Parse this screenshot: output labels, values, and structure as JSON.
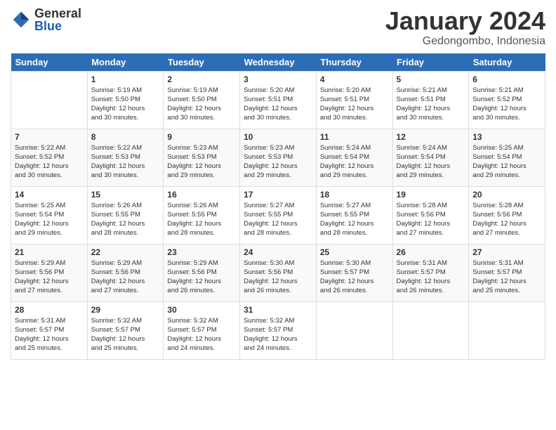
{
  "header": {
    "logo_general": "General",
    "logo_blue": "Blue",
    "month_title": "January 2024",
    "location": "Gedongombo, Indonesia"
  },
  "days_of_week": [
    "Sunday",
    "Monday",
    "Tuesday",
    "Wednesday",
    "Thursday",
    "Friday",
    "Saturday"
  ],
  "weeks": [
    [
      {
        "day": "",
        "info": ""
      },
      {
        "day": "1",
        "info": "Sunrise: 5:19 AM\nSunset: 5:50 PM\nDaylight: 12 hours\nand 30 minutes."
      },
      {
        "day": "2",
        "info": "Sunrise: 5:19 AM\nSunset: 5:50 PM\nDaylight: 12 hours\nand 30 minutes."
      },
      {
        "day": "3",
        "info": "Sunrise: 5:20 AM\nSunset: 5:51 PM\nDaylight: 12 hours\nand 30 minutes."
      },
      {
        "day": "4",
        "info": "Sunrise: 5:20 AM\nSunset: 5:51 PM\nDaylight: 12 hours\nand 30 minutes."
      },
      {
        "day": "5",
        "info": "Sunrise: 5:21 AM\nSunset: 5:51 PM\nDaylight: 12 hours\nand 30 minutes."
      },
      {
        "day": "6",
        "info": "Sunrise: 5:21 AM\nSunset: 5:52 PM\nDaylight: 12 hours\nand 30 minutes."
      }
    ],
    [
      {
        "day": "7",
        "info": "Sunrise: 5:22 AM\nSunset: 5:52 PM\nDaylight: 12 hours\nand 30 minutes."
      },
      {
        "day": "8",
        "info": "Sunrise: 5:22 AM\nSunset: 5:53 PM\nDaylight: 12 hours\nand 30 minutes."
      },
      {
        "day": "9",
        "info": "Sunrise: 5:23 AM\nSunset: 5:53 PM\nDaylight: 12 hours\nand 29 minutes."
      },
      {
        "day": "10",
        "info": "Sunrise: 5:23 AM\nSunset: 5:53 PM\nDaylight: 12 hours\nand 29 minutes."
      },
      {
        "day": "11",
        "info": "Sunrise: 5:24 AM\nSunset: 5:54 PM\nDaylight: 12 hours\nand 29 minutes."
      },
      {
        "day": "12",
        "info": "Sunrise: 5:24 AM\nSunset: 5:54 PM\nDaylight: 12 hours\nand 29 minutes."
      },
      {
        "day": "13",
        "info": "Sunrise: 5:25 AM\nSunset: 5:54 PM\nDaylight: 12 hours\nand 29 minutes."
      }
    ],
    [
      {
        "day": "14",
        "info": "Sunrise: 5:25 AM\nSunset: 5:54 PM\nDaylight: 12 hours\nand 29 minutes."
      },
      {
        "day": "15",
        "info": "Sunrise: 5:26 AM\nSunset: 5:55 PM\nDaylight: 12 hours\nand 28 minutes."
      },
      {
        "day": "16",
        "info": "Sunrise: 5:26 AM\nSunset: 5:55 PM\nDaylight: 12 hours\nand 28 minutes."
      },
      {
        "day": "17",
        "info": "Sunrise: 5:27 AM\nSunset: 5:55 PM\nDaylight: 12 hours\nand 28 minutes."
      },
      {
        "day": "18",
        "info": "Sunrise: 5:27 AM\nSunset: 5:55 PM\nDaylight: 12 hours\nand 28 minutes."
      },
      {
        "day": "19",
        "info": "Sunrise: 5:28 AM\nSunset: 5:56 PM\nDaylight: 12 hours\nand 27 minutes."
      },
      {
        "day": "20",
        "info": "Sunrise: 5:28 AM\nSunset: 5:56 PM\nDaylight: 12 hours\nand 27 minutes."
      }
    ],
    [
      {
        "day": "21",
        "info": "Sunrise: 5:29 AM\nSunset: 5:56 PM\nDaylight: 12 hours\nand 27 minutes."
      },
      {
        "day": "22",
        "info": "Sunrise: 5:29 AM\nSunset: 5:56 PM\nDaylight: 12 hours\nand 27 minutes."
      },
      {
        "day": "23",
        "info": "Sunrise: 5:29 AM\nSunset: 5:56 PM\nDaylight: 12 hours\nand 26 minutes."
      },
      {
        "day": "24",
        "info": "Sunrise: 5:30 AM\nSunset: 5:56 PM\nDaylight: 12 hours\nand 26 minutes."
      },
      {
        "day": "25",
        "info": "Sunrise: 5:30 AM\nSunset: 5:57 PM\nDaylight: 12 hours\nand 26 minutes."
      },
      {
        "day": "26",
        "info": "Sunrise: 5:31 AM\nSunset: 5:57 PM\nDaylight: 12 hours\nand 26 minutes."
      },
      {
        "day": "27",
        "info": "Sunrise: 5:31 AM\nSunset: 5:57 PM\nDaylight: 12 hours\nand 25 minutes."
      }
    ],
    [
      {
        "day": "28",
        "info": "Sunrise: 5:31 AM\nSunset: 5:57 PM\nDaylight: 12 hours\nand 25 minutes."
      },
      {
        "day": "29",
        "info": "Sunrise: 5:32 AM\nSunset: 5:57 PM\nDaylight: 12 hours\nand 25 minutes."
      },
      {
        "day": "30",
        "info": "Sunrise: 5:32 AM\nSunset: 5:57 PM\nDaylight: 12 hours\nand 24 minutes."
      },
      {
        "day": "31",
        "info": "Sunrise: 5:32 AM\nSunset: 5:57 PM\nDaylight: 12 hours\nand 24 minutes."
      },
      {
        "day": "",
        "info": ""
      },
      {
        "day": "",
        "info": ""
      },
      {
        "day": "",
        "info": ""
      }
    ]
  ]
}
